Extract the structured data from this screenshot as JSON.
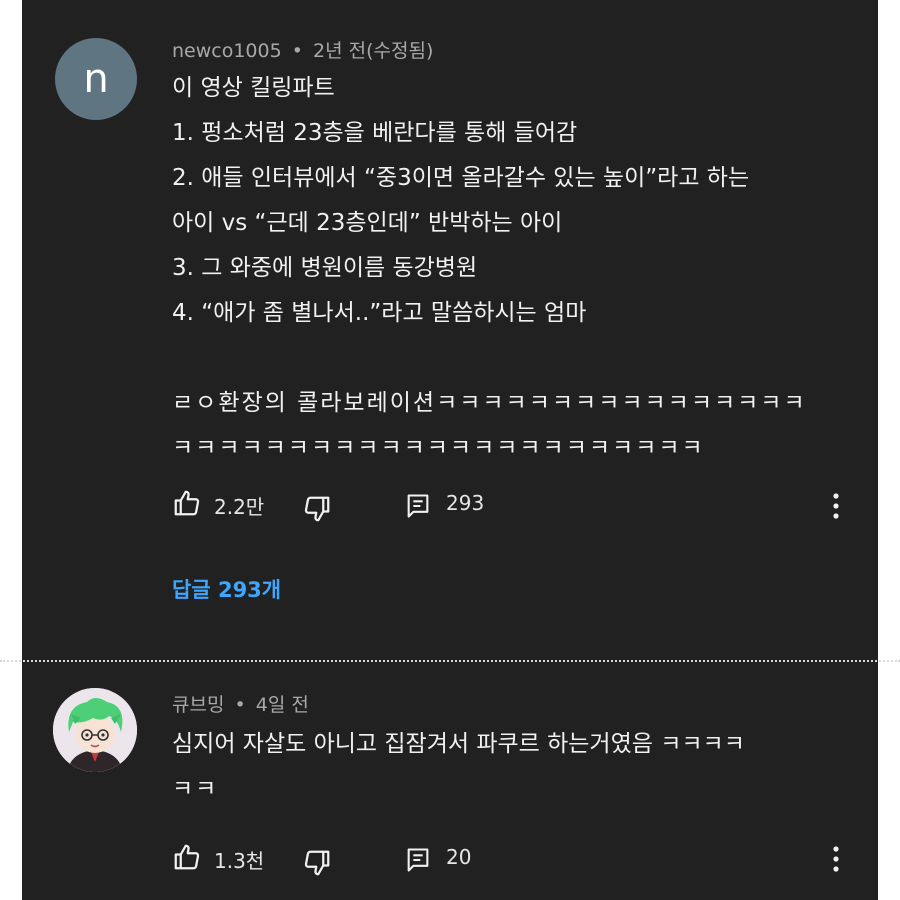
{
  "comments": [
    {
      "author": "newco1005",
      "avatar_letter": "n",
      "separator": "•",
      "time": "2년 전(수정됨)",
      "lines": [
        "이 영상 킬링파트",
        "1. 펑소처럼 23층을 베란다를 통해 들어감",
        "2. 애들 인터뷰에서 “중3이면 올라갈수 있는 높이”라고 하는",
        "아이 vs “근데 23층인데” 반박하는 아이",
        "3. 그 와중에 병원이름 동강병원",
        "4. “애가 좀 별나서..”라고 말씀하시는 엄마",
        "",
        "ㄹㅇ환장의 콜라보레이션ㅋㅋㅋㅋㅋㅋㅋㅋㅋㅋㅋㅋㅋㅋㅋㅋ",
        "ㅋㅋㅋㅋㅋㅋㅋㅋㅋㅋㅋㅋㅋㅋㅋㅋㅋㅋㅋㅋㅋㅋㅋ"
      ],
      "likes": "2.2만",
      "replies_count": "293",
      "replies_link": "답글 293개",
      "like_icon": "thumbs-up-icon",
      "dislike_icon": "thumbs-down-icon",
      "reply_icon": "reply-icon",
      "more_icon": "more-vert-icon"
    },
    {
      "author": "큐브밍",
      "separator": "•",
      "time": "4일 전",
      "lines": [
        "심지어 자살도 아니고 집잠겨서 파쿠르 하는거였음 ㅋㅋㅋㅋ",
        "ㅋㅋ"
      ],
      "likes": "1.3천",
      "replies_count": "20",
      "like_icon": "thumbs-up-icon",
      "dislike_icon": "thumbs-down-icon",
      "reply_icon": "reply-icon",
      "more_icon": "more-vert-icon"
    }
  ],
  "colors": {
    "background": "#212121",
    "text": "#f1f1f1",
    "meta": "#a8a8a8",
    "link": "#3ea6ff",
    "avatar": "#5f7582"
  }
}
